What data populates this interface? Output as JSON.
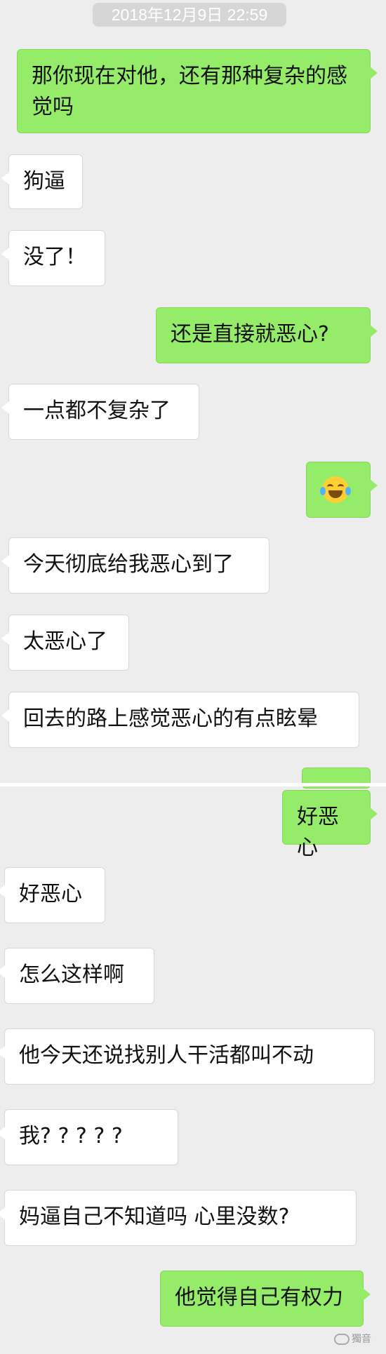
{
  "timestamp": "2018年12月9日  22:59",
  "messages": [
    {
      "side": "out",
      "text": "那你现在对他，还有那种复杂的感觉吗"
    },
    {
      "side": "in",
      "text": "狗逼"
    },
    {
      "side": "in",
      "text": "没了！"
    },
    {
      "side": "out",
      "text": "还是直接就恶心?"
    },
    {
      "side": "in",
      "text": "一点都不复杂了"
    },
    {
      "side": "out",
      "emoji": "face-with-tears-of-joy"
    },
    {
      "side": "in",
      "text": "今天彻底给我恶心到了"
    },
    {
      "side": "in",
      "text": "太恶心了"
    },
    {
      "side": "in",
      "text": "回去的路上感觉恶心的有点眩晕"
    },
    {
      "side": "out",
      "text": "好恶心"
    },
    {
      "side": "in",
      "text": "好恶心"
    },
    {
      "side": "in",
      "text": "怎么这样啊"
    },
    {
      "side": "in",
      "text": "他今天还说找别人干活都叫不动"
    },
    {
      "side": "in",
      "text": "我? ? ? ? ?"
    },
    {
      "side": "in",
      "text": "妈逼自己不知道吗 心里没数?"
    },
    {
      "side": "out",
      "text": "他觉得自己有权力"
    }
  ],
  "watermark": "獨音",
  "colors": {
    "background": "#ededed",
    "incoming": "#ffffff",
    "outgoing": "#95ec69",
    "timestamp_pill": "#d6d6d6"
  }
}
